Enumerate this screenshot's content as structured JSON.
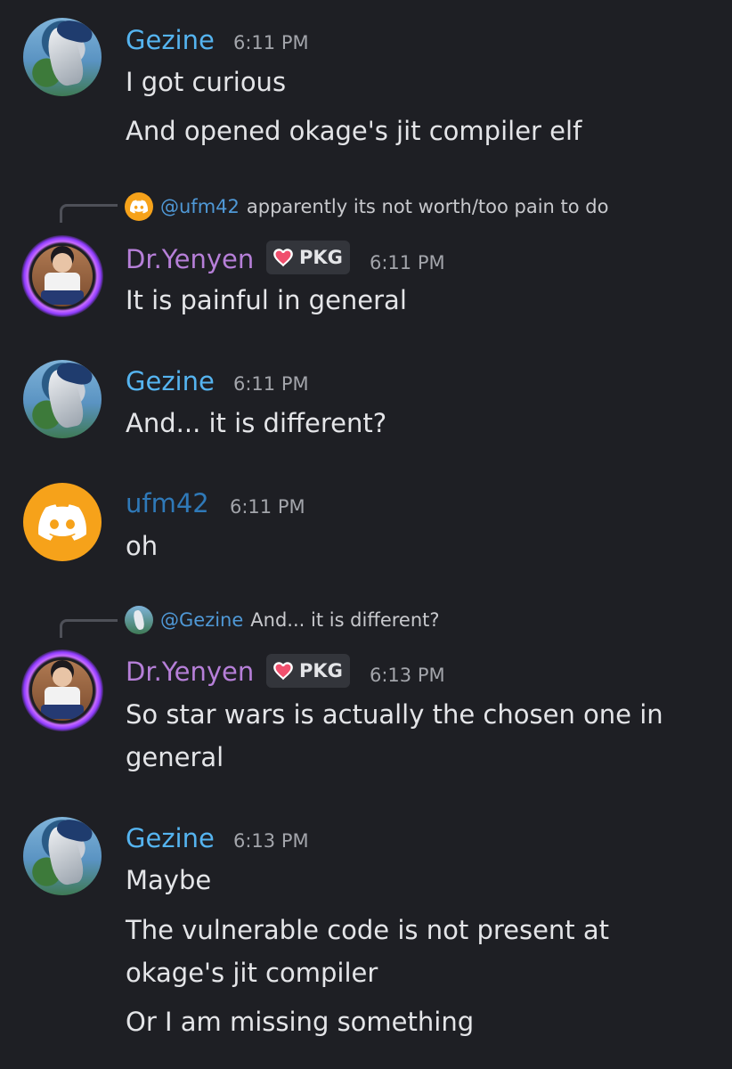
{
  "messages": [
    {
      "author": "Gezine",
      "time": "6:11 PM",
      "lines": [
        "I got curious",
        "And opened okage's jit compiler elf"
      ]
    },
    {
      "reply": {
        "mention": "@ufm42",
        "text": "apparently its not worth/too pain to do"
      },
      "author": "Dr.Yenyen",
      "badge": "PKG",
      "time": "6:11 PM",
      "lines": [
        "It is painful in general"
      ]
    },
    {
      "author": "Gezine",
      "time": "6:11 PM",
      "lines": [
        "And... it is different?"
      ]
    },
    {
      "author": "ufm42",
      "time": "6:11 PM",
      "lines": [
        "oh"
      ]
    },
    {
      "reply": {
        "mention": "@Gezine",
        "text": "And... it is different?"
      },
      "author": "Dr.Yenyen",
      "badge": "PKG",
      "time": "6:13 PM",
      "lines": [
        "So star wars is actually the chosen one in",
        "general"
      ]
    },
    {
      "author": "Gezine",
      "time": "6:13 PM",
      "lines": [
        "Maybe",
        "The vulnerable code is not present at",
        "okage's jit compiler",
        "Or I am missing something"
      ]
    }
  ],
  "icons": {
    "discord_avatar": "discord-icon",
    "badge_icon": "heart-icon"
  },
  "colors": {
    "background": "#1e1f24",
    "gezine_name": "#55b4f0",
    "yenyen_name": "#b67fd8",
    "ufm42_name": "#2f79b8",
    "discord_avatar_bg": "#f6a21a",
    "reply_mention": "#4f98d6"
  }
}
